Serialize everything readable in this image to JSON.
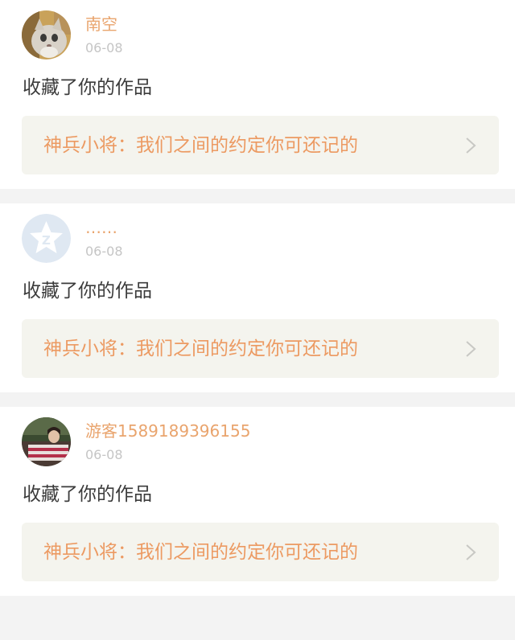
{
  "notifications": [
    {
      "username": "南空",
      "date": "06-08",
      "action": "收藏了你的作品",
      "work_title": "神兵小将：我们之间的约定你可还记的",
      "avatar_icon": "cat-photo-avatar"
    },
    {
      "username": "……",
      "date": "06-08",
      "action": "收藏了你的作品",
      "work_title": "神兵小将：我们之间的约定你可还记的",
      "avatar_icon": "default-star-avatar"
    },
    {
      "username": "游客1589189396155",
      "date": "06-08",
      "action": "收藏了你的作品",
      "work_title": "神兵小将：我们之间的约定你可还记的",
      "avatar_icon": "person-photo-avatar"
    }
  ],
  "colors": {
    "username": "#e9a46d",
    "date": "#c5c5c5",
    "action_text": "#3b3b3b",
    "work_title": "#ec9a62",
    "link_background": "#f4f4ee",
    "separator": "#f3f3f3",
    "default_avatar_bg": "#dfe8f2"
  }
}
